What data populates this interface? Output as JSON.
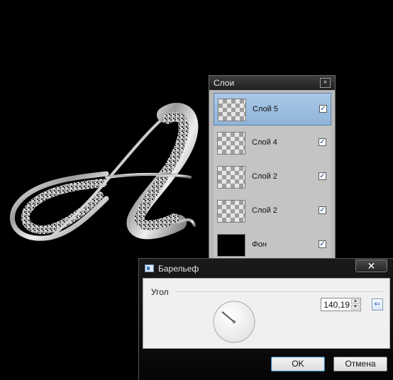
{
  "layers_panel": {
    "title": "Слои",
    "close_glyph": "×",
    "layers": [
      {
        "name": "Слой 5",
        "visible": true,
        "selected": true,
        "thumbnail": "transparent"
      },
      {
        "name": "Слой 4",
        "visible": true,
        "selected": false,
        "thumbnail": "transparent"
      },
      {
        "name": "Слой 2",
        "visible": true,
        "selected": false,
        "thumbnail": "transparent"
      },
      {
        "name": "Слой 2",
        "visible": true,
        "selected": false,
        "thumbnail": "transparent"
      },
      {
        "name": "Фон",
        "visible": true,
        "selected": false,
        "thumbnail": "black"
      }
    ]
  },
  "canvas": {
    "artwork_letter": "A",
    "background_color": "#000000"
  },
  "dialog": {
    "title": "Барельеф",
    "close_glyph": "✕",
    "angle_label": "Угол",
    "angle_value": "140,19",
    "ok_label": "OK",
    "cancel_label": "Отмена",
    "icons": {
      "app": "dialog-app-icon",
      "reset": "reset-arrow-icon",
      "spin_up": "spin-up-arrow",
      "spin_down": "spin-down-arrow"
    }
  },
  "colors": {
    "selection": "#9fbfe2",
    "panel_bg": "#b9b9b9",
    "dialog_client": "#f0f0f0",
    "default_button_border": "#3c7fb1"
  }
}
